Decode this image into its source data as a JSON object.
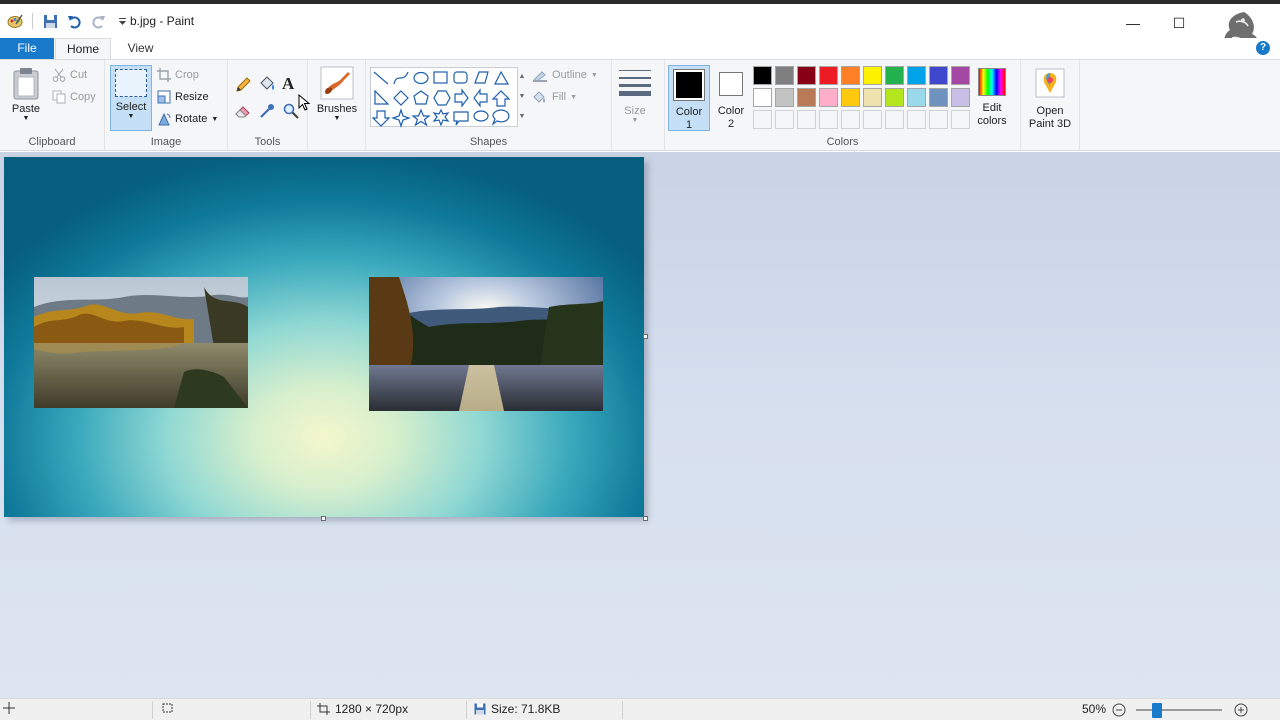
{
  "window": {
    "title": "b.jpg - Paint",
    "minimize": "—",
    "maximize": "☐",
    "help": "?"
  },
  "tabs": {
    "file": "File",
    "home": "Home",
    "view": "View"
  },
  "clipboard": {
    "paste": "Paste",
    "cut": "Cut",
    "copy": "Copy",
    "label": "Clipboard"
  },
  "image": {
    "select": "Select",
    "crop": "Crop",
    "resize": "Resize",
    "rotate": "Rotate",
    "label": "Image"
  },
  "tools": {
    "label": "Tools",
    "text_icon": "A"
  },
  "brushes": {
    "label": "Brushes"
  },
  "shapes": {
    "outline": "Outline",
    "fill": "Fill",
    "label": "Shapes"
  },
  "size": {
    "label": "Size"
  },
  "colors": {
    "color1_line1": "Color",
    "color1_line2": "1",
    "color2_line1": "Color",
    "color2_line2": "2",
    "edit_line1": "Edit",
    "edit_line2": "colors",
    "label": "Colors",
    "color1": "#000000",
    "color2": "#ffffff",
    "palette_row1": [
      "#000000",
      "#7f7f7f",
      "#880015",
      "#ed1c24",
      "#ff7f27",
      "#fff200",
      "#22b14c",
      "#00a2e8",
      "#3f48cc",
      "#a349a4"
    ],
    "palette_row2": [
      "#ffffff",
      "#c3c3c3",
      "#b97a57",
      "#ffaec9",
      "#ffc90e",
      "#efe4b0",
      "#b5e61d",
      "#99d9ea",
      "#7092be",
      "#c8bfe7"
    ]
  },
  "paint3d": {
    "line1": "Open",
    "line2": "Paint 3D"
  },
  "status": {
    "dimensions": "1280 × 720px",
    "size": "Size: 71.8KB",
    "zoom": "50%"
  }
}
